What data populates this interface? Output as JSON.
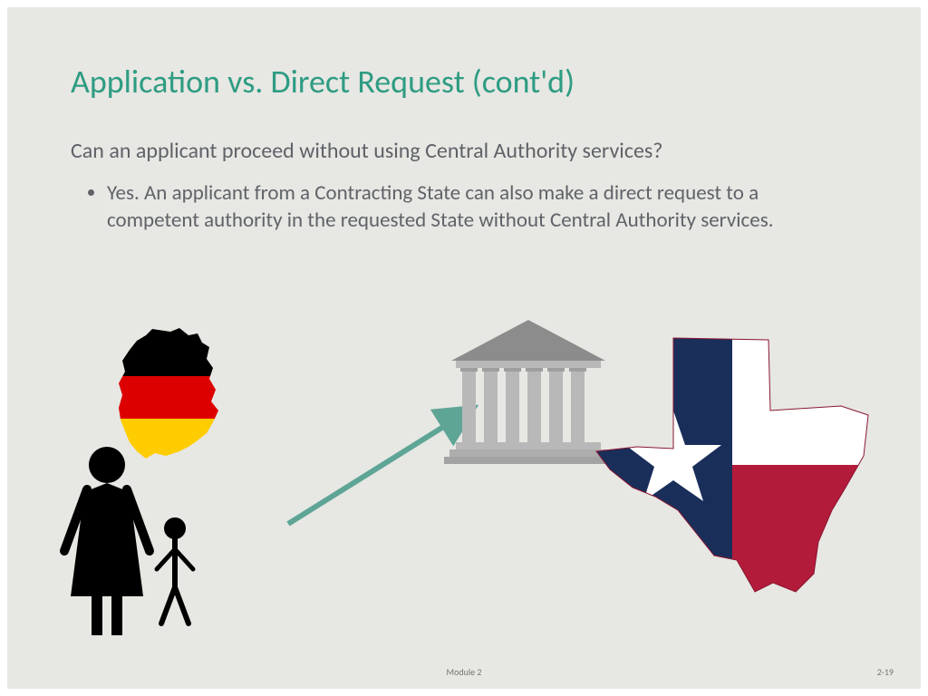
{
  "title": "Application vs. Direct Request (cont'd)",
  "question": "Can an applicant proceed without using Central Authority services?",
  "bullet": "Yes.  An applicant from a Contracting State can also make a direct request to a competent authority in the requested State without Central Authority services.",
  "footer_center": "Module 2",
  "footer_right": "2-19"
}
